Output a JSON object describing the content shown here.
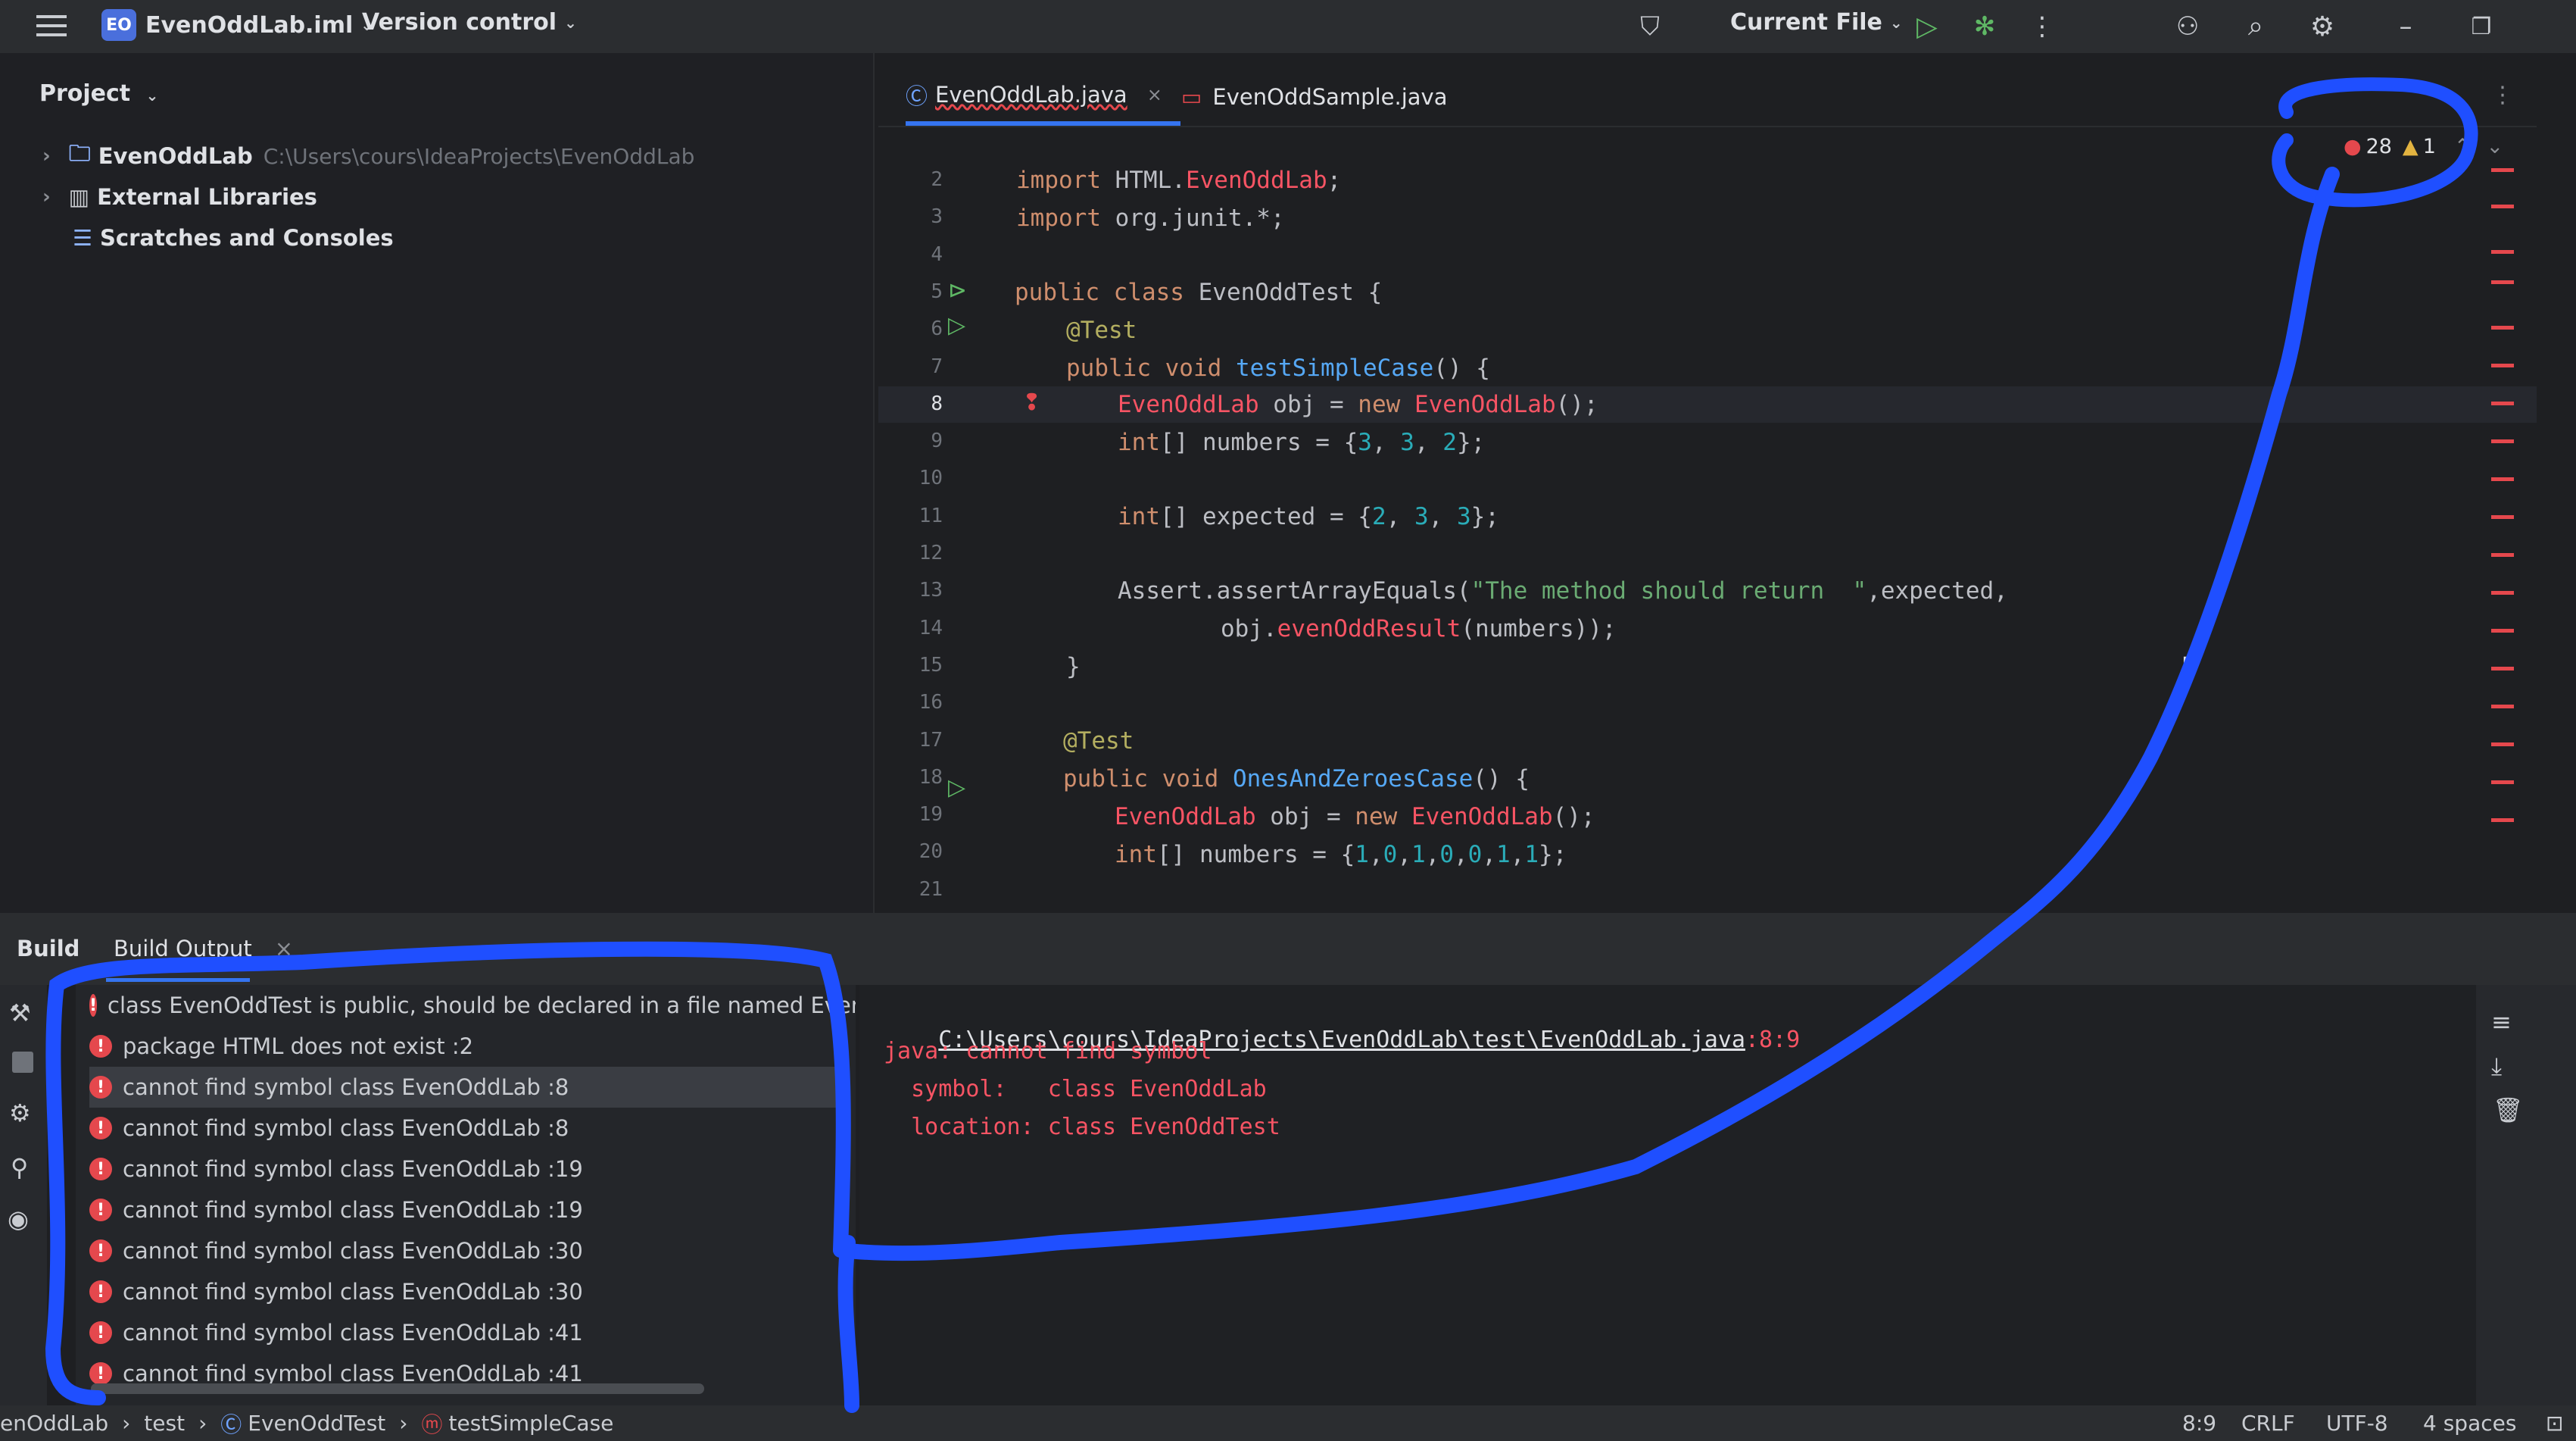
{
  "titlebar": {
    "project_badge": "EO",
    "project_name": "EvenOddLab.iml",
    "vcs": "Version control",
    "run_config": "Current File"
  },
  "project_panel": {
    "title": "Project",
    "tree": [
      {
        "label": "EvenOddLab",
        "path": "C:\\Users\\cours\\IdeaProjects\\EvenOddLab"
      },
      {
        "label": "External Libraries"
      },
      {
        "label": "Scratches and Consoles"
      }
    ]
  },
  "editor": {
    "tabs": [
      {
        "label": "EvenOddLab.java",
        "active": true
      },
      {
        "label": "EvenOddSample.java"
      }
    ],
    "error_count": "28",
    "warning_count": "1",
    "line_numbers": [
      "2",
      "3",
      "4",
      "5",
      "6",
      "7",
      "8",
      "9",
      "10",
      "11",
      "12",
      "13",
      "14",
      "15",
      "16",
      "17",
      "18",
      "19",
      "20",
      "21"
    ]
  },
  "build": {
    "tab_build": "Build",
    "tab_output": "Build Output",
    "items": [
      "class EvenOddTest is public, should be declared in a file named EvenOd",
      "package HTML does not exist :2",
      "cannot find symbol class EvenOddLab :8",
      "cannot find symbol class EvenOddLab :8",
      "cannot find symbol class EvenOddLab :19",
      "cannot find symbol class EvenOddLab :19",
      "cannot find symbol class EvenOddLab :30",
      "cannot find symbol class EvenOddLab :30",
      "cannot find symbol class EvenOddLab :41",
      "cannot find symbol class EvenOddLab :41"
    ],
    "message": {
      "path": "C:\\Users\\cours\\IdeaProjects\\EvenOddLab\\test\\EvenOddLab.java",
      "position": ":8:9",
      "line1": "java: cannot find symbol",
      "line2": "  symbol:   class EvenOddLab",
      "line3": "  location: class EvenOddTest"
    }
  },
  "statusbar": {
    "crumbs": [
      "enOddLab",
      "test",
      "EvenOddTest",
      "testSimpleCase"
    ],
    "position": "8:9",
    "line_sep": "CRLF",
    "encoding": "UTF-8",
    "indent": "4 spaces"
  },
  "colors": {
    "accent": "#3574f0",
    "error": "#e5484d",
    "annotation": "#1f4fff"
  }
}
